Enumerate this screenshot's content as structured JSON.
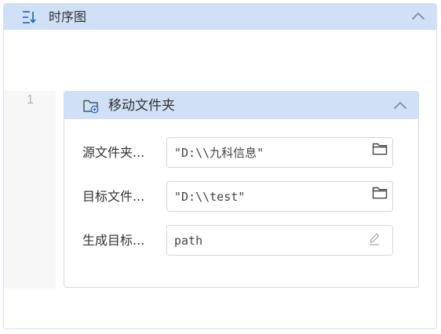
{
  "outer_panel": {
    "title": "时序图",
    "icon": "sequence-list-icon",
    "collapse_icon": "chevron-up-icon"
  },
  "gutter": {
    "line_number": "1"
  },
  "card": {
    "title": "移动文件夹",
    "icon": "folder-add-icon",
    "collapse_icon": "chevron-up-icon",
    "fields": [
      {
        "label": "源文件夹...",
        "value": "\"D:\\\\九科信息\"",
        "icon": "folder-icon"
      },
      {
        "label": "目标文件...",
        "value": "\"D:\\\\test\"",
        "icon": "folder-icon"
      },
      {
        "label": "生成目标...",
        "value": "path",
        "icon": "edit-pencil-icon"
      }
    ]
  },
  "colors": {
    "header_bg": "#cfe0f7",
    "accent": "#2f6fc0"
  }
}
